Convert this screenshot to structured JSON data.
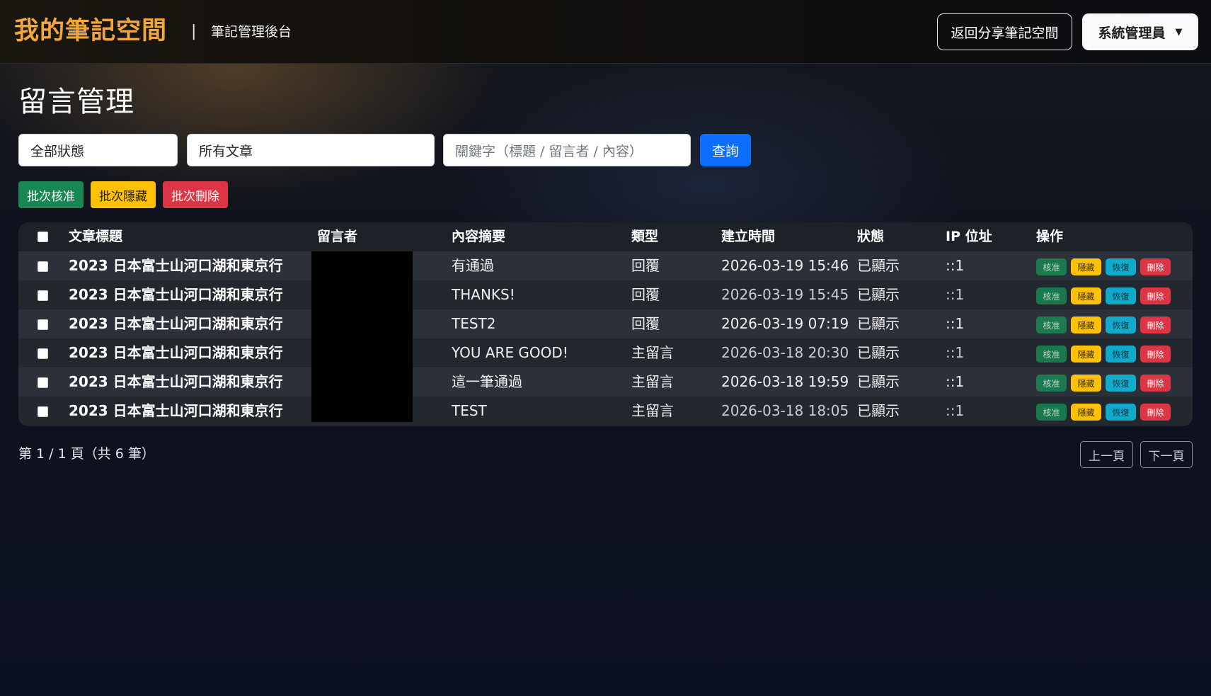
{
  "navbar": {
    "brand": "我的筆記空間",
    "separator": "|",
    "subtitle": "筆記管理後台",
    "back_button": "返回分享筆記空間",
    "user_menu": "系統管理員",
    "user_menu_caret": "▼"
  },
  "page": {
    "title": "留言管理"
  },
  "filters": {
    "status_value": "全部狀態",
    "article_value": "所有文章",
    "keyword_placeholder": "關鍵字（標題 / 留言者 / 內容）",
    "query_button": "查詢"
  },
  "batch": {
    "approve": "批次核准",
    "hide": "批次隱藏",
    "delete": "批次刪除"
  },
  "table": {
    "headers": {
      "title": "文章標題",
      "author": "留言者",
      "summary": "內容摘要",
      "type": "類型",
      "created": "建立時間",
      "status": "狀態",
      "ip": "IP 位址",
      "actions": "操作"
    },
    "rows": [
      {
        "title": "2023 日本富士山河口湖和東京行",
        "summary": "有通過",
        "type": "回覆",
        "created": "2026-03-19 15:46",
        "status": "已顯示",
        "ip": "::1"
      },
      {
        "title": "2023 日本富士山河口湖和東京行",
        "summary": "THANKS!",
        "type": "回覆",
        "created": "2026-03-19 15:45",
        "status": "已顯示",
        "ip": "::1"
      },
      {
        "title": "2023 日本富士山河口湖和東京行",
        "summary": "TEST2",
        "type": "回覆",
        "created": "2026-03-19 07:19",
        "status": "已顯示",
        "ip": "::1"
      },
      {
        "title": "2023 日本富士山河口湖和東京行",
        "summary": "YOU ARE GOOD!",
        "type": "主留言",
        "created": "2026-03-18 20:30",
        "status": "已顯示",
        "ip": "::1"
      },
      {
        "title": "2023 日本富士山河口湖和東京行",
        "summary": "這一筆通過",
        "type": "主留言",
        "created": "2026-03-18 19:59",
        "status": "已顯示",
        "ip": "::1"
      },
      {
        "title": "2023 日本富士山河口湖和東京行",
        "summary": "TEST",
        "type": "主留言",
        "created": "2026-03-18 18:05",
        "status": "已顯示",
        "ip": "::1"
      }
    ],
    "row_actions": {
      "approve": "核准",
      "hide": "隱藏",
      "restore": "恢復",
      "delete": "刪除"
    }
  },
  "pagination": {
    "info": "第 1 / 1 頁（共 6 筆）",
    "prev": "上一頁",
    "next": "下一頁"
  },
  "colors": {
    "brand": "#f3a63a",
    "primary": "#0d6efd",
    "success": "#198754",
    "warning": "#ffc107",
    "danger": "#dc3545",
    "info": "#0dcaf0"
  }
}
